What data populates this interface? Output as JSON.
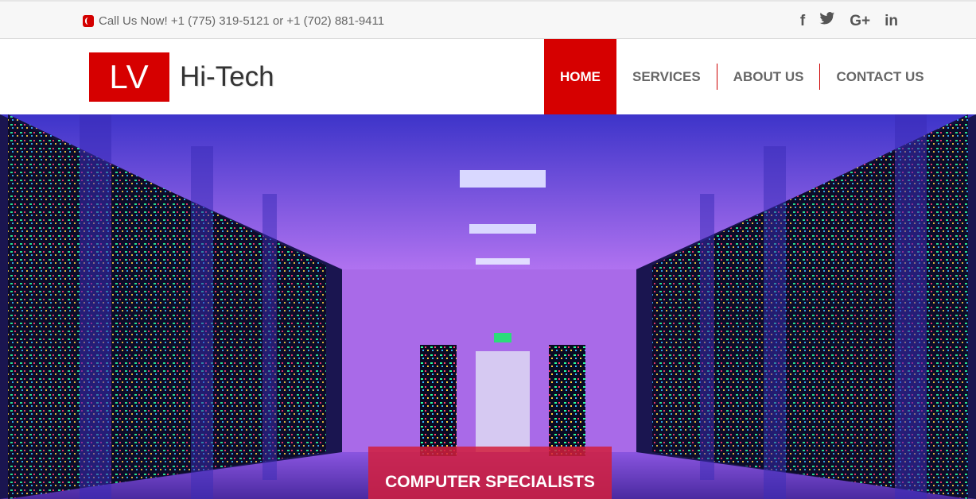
{
  "topbar": {
    "phone_text": "Call Us Now! +1 (775) 319-5121 or +1 (702) 881-9411",
    "social": {
      "facebook": "f",
      "twitter": "🐦",
      "google": "G+",
      "linkedin": "in"
    }
  },
  "logo": {
    "mark": "LV",
    "text": "Hi-Tech"
  },
  "nav": {
    "home": "HOME",
    "services": "SERVICES",
    "about": "ABOUT US",
    "contact": "CONTACT US"
  },
  "hero": {
    "cta": "COMPUTER SPECIALISTS",
    "exit_sign": "EXIT"
  },
  "colors": {
    "accent": "#d60000"
  }
}
